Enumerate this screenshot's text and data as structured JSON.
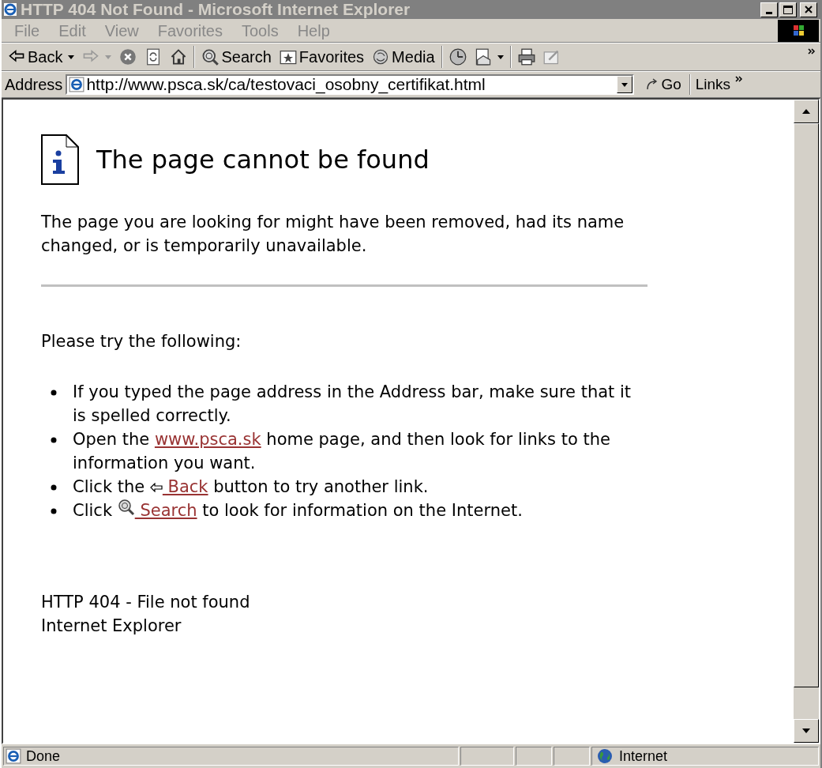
{
  "window": {
    "title": "HTTP 404 Not Found - Microsoft Internet Explorer"
  },
  "menu_bar": [
    "File",
    "Edit",
    "View",
    "Favorites",
    "Tools",
    "Help"
  ],
  "toolbar": [
    {
      "kind": "back",
      "label": "Back"
    },
    {
      "kind": "forward"
    },
    {
      "kind": "stop"
    },
    {
      "kind": "refresh"
    },
    {
      "kind": "home"
    },
    {
      "kind": "search",
      "label": "Search"
    },
    {
      "kind": "favorites",
      "label": "Favorites"
    },
    {
      "kind": "media",
      "label": "Media"
    },
    {
      "kind": "history"
    },
    {
      "kind": "mail"
    },
    {
      "kind": "print"
    },
    {
      "kind": "edit"
    }
  ],
  "address_bar": {
    "label": "Address",
    "value": "http://www.psca.sk/ca/testovaci_osobny_certifikat.html",
    "go": "Go",
    "links": "Links"
  },
  "page": {
    "heading": "The page cannot be found",
    "intro": "The page you are looking for might have been removed, had its name changed, or is temporarily unavailable.",
    "try_heading": "Please try the following:",
    "bullets": [
      [
        {
          "kind": "text",
          "text": "If you typed the page address in the Address bar, make sure that it is spelled correctly."
        }
      ],
      [
        {
          "kind": "text",
          "text": "Open the "
        },
        {
          "kind": "link",
          "text": "www.psca.sk"
        },
        {
          "kind": "text",
          "text": " home page, and then look for links to the information you want."
        }
      ],
      [
        {
          "kind": "text",
          "text": "Click the "
        },
        {
          "kind": "back_icon"
        },
        {
          "kind": "link",
          "text": " Back"
        },
        {
          "kind": "text",
          "text": " button to try another link."
        }
      ],
      [
        {
          "kind": "text",
          "text": "Click "
        },
        {
          "kind": "search_icon"
        },
        {
          "kind": "link",
          "text": " Search"
        },
        {
          "kind": "text",
          "text": " to look for information on the Internet."
        }
      ]
    ],
    "footer": [
      "HTTP 404 - File not found",
      "Internet Explorer"
    ]
  },
  "status_bar": {
    "text": "Done",
    "zone": "Internet"
  }
}
